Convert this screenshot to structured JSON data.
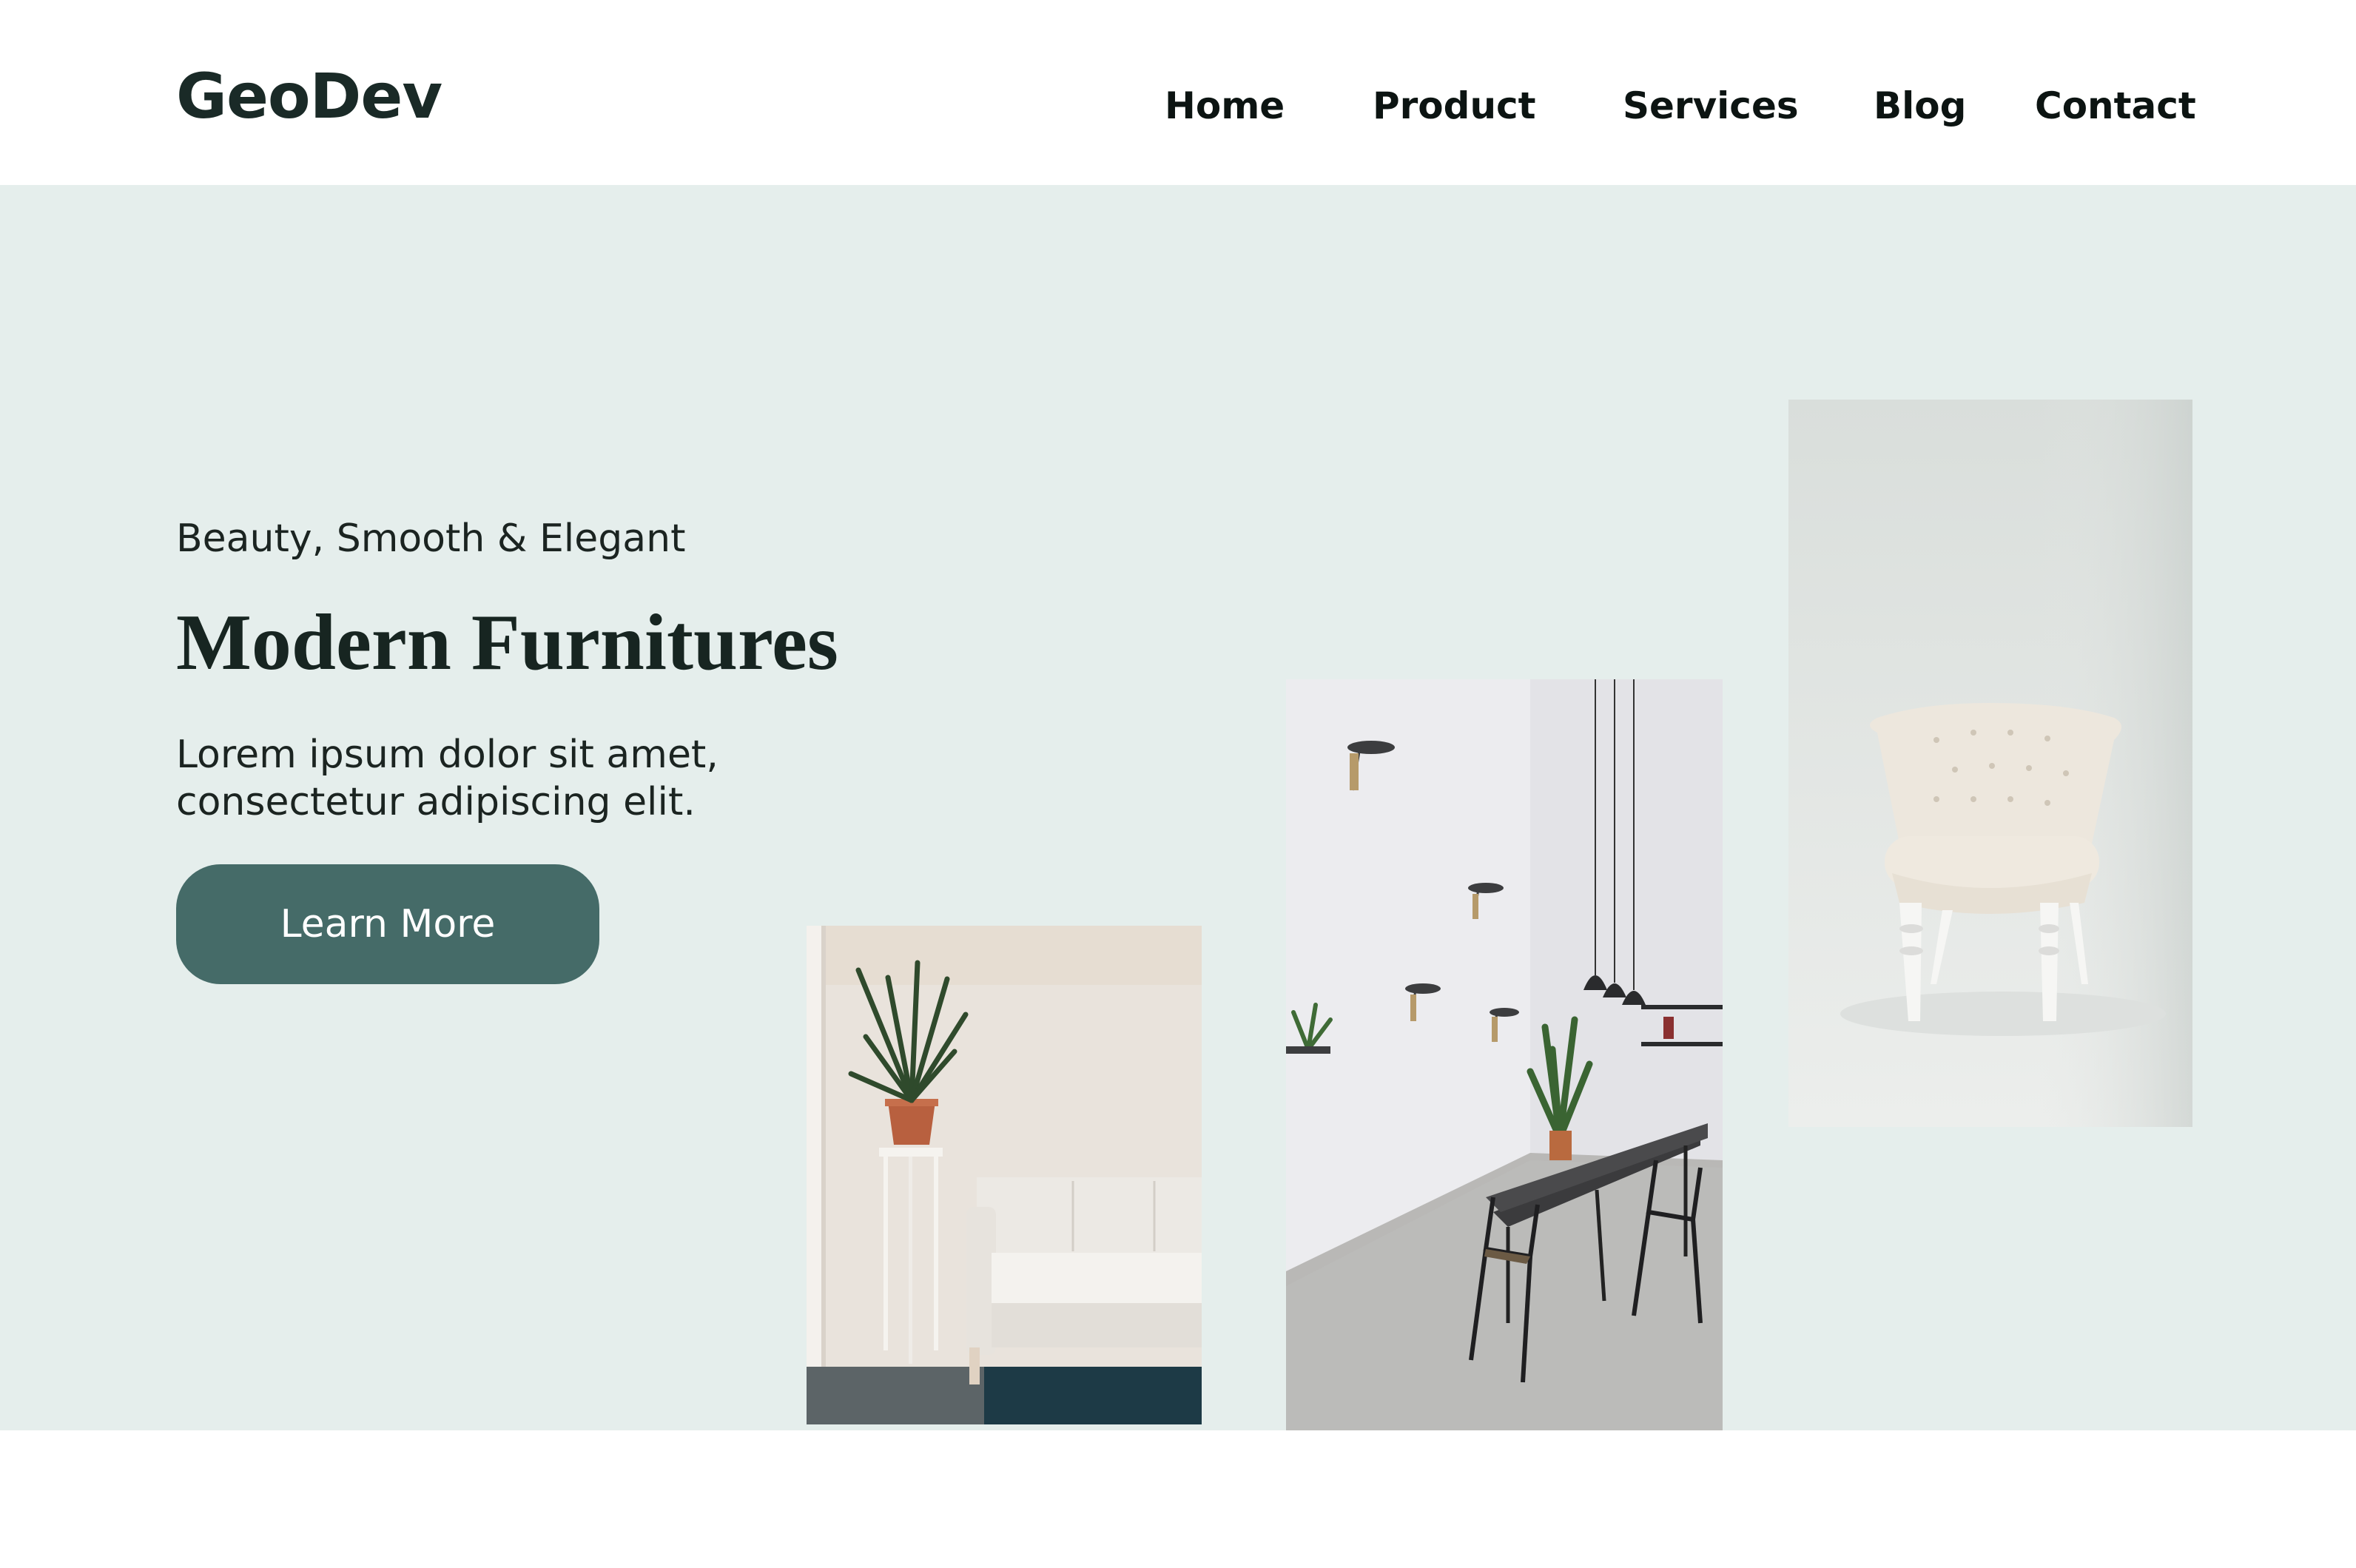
{
  "brand": {
    "logo_text": "GeoDev"
  },
  "nav": {
    "items": [
      {
        "label": "Home"
      },
      {
        "label": "Product"
      },
      {
        "label": "Services"
      },
      {
        "label": "Blog"
      },
      {
        "label": "Contact"
      }
    ]
  },
  "hero": {
    "tagline": "Beauty, Smooth & Elegant",
    "headline": "Modern Furnitures",
    "description": "Lorem ipsum dolor sit amet, consectetur adipiscing elit.",
    "cta_label": "Learn More"
  },
  "colors": {
    "hero_background": "#e5eeec",
    "cta_background": "#456b68",
    "text_dark": "#132320"
  }
}
